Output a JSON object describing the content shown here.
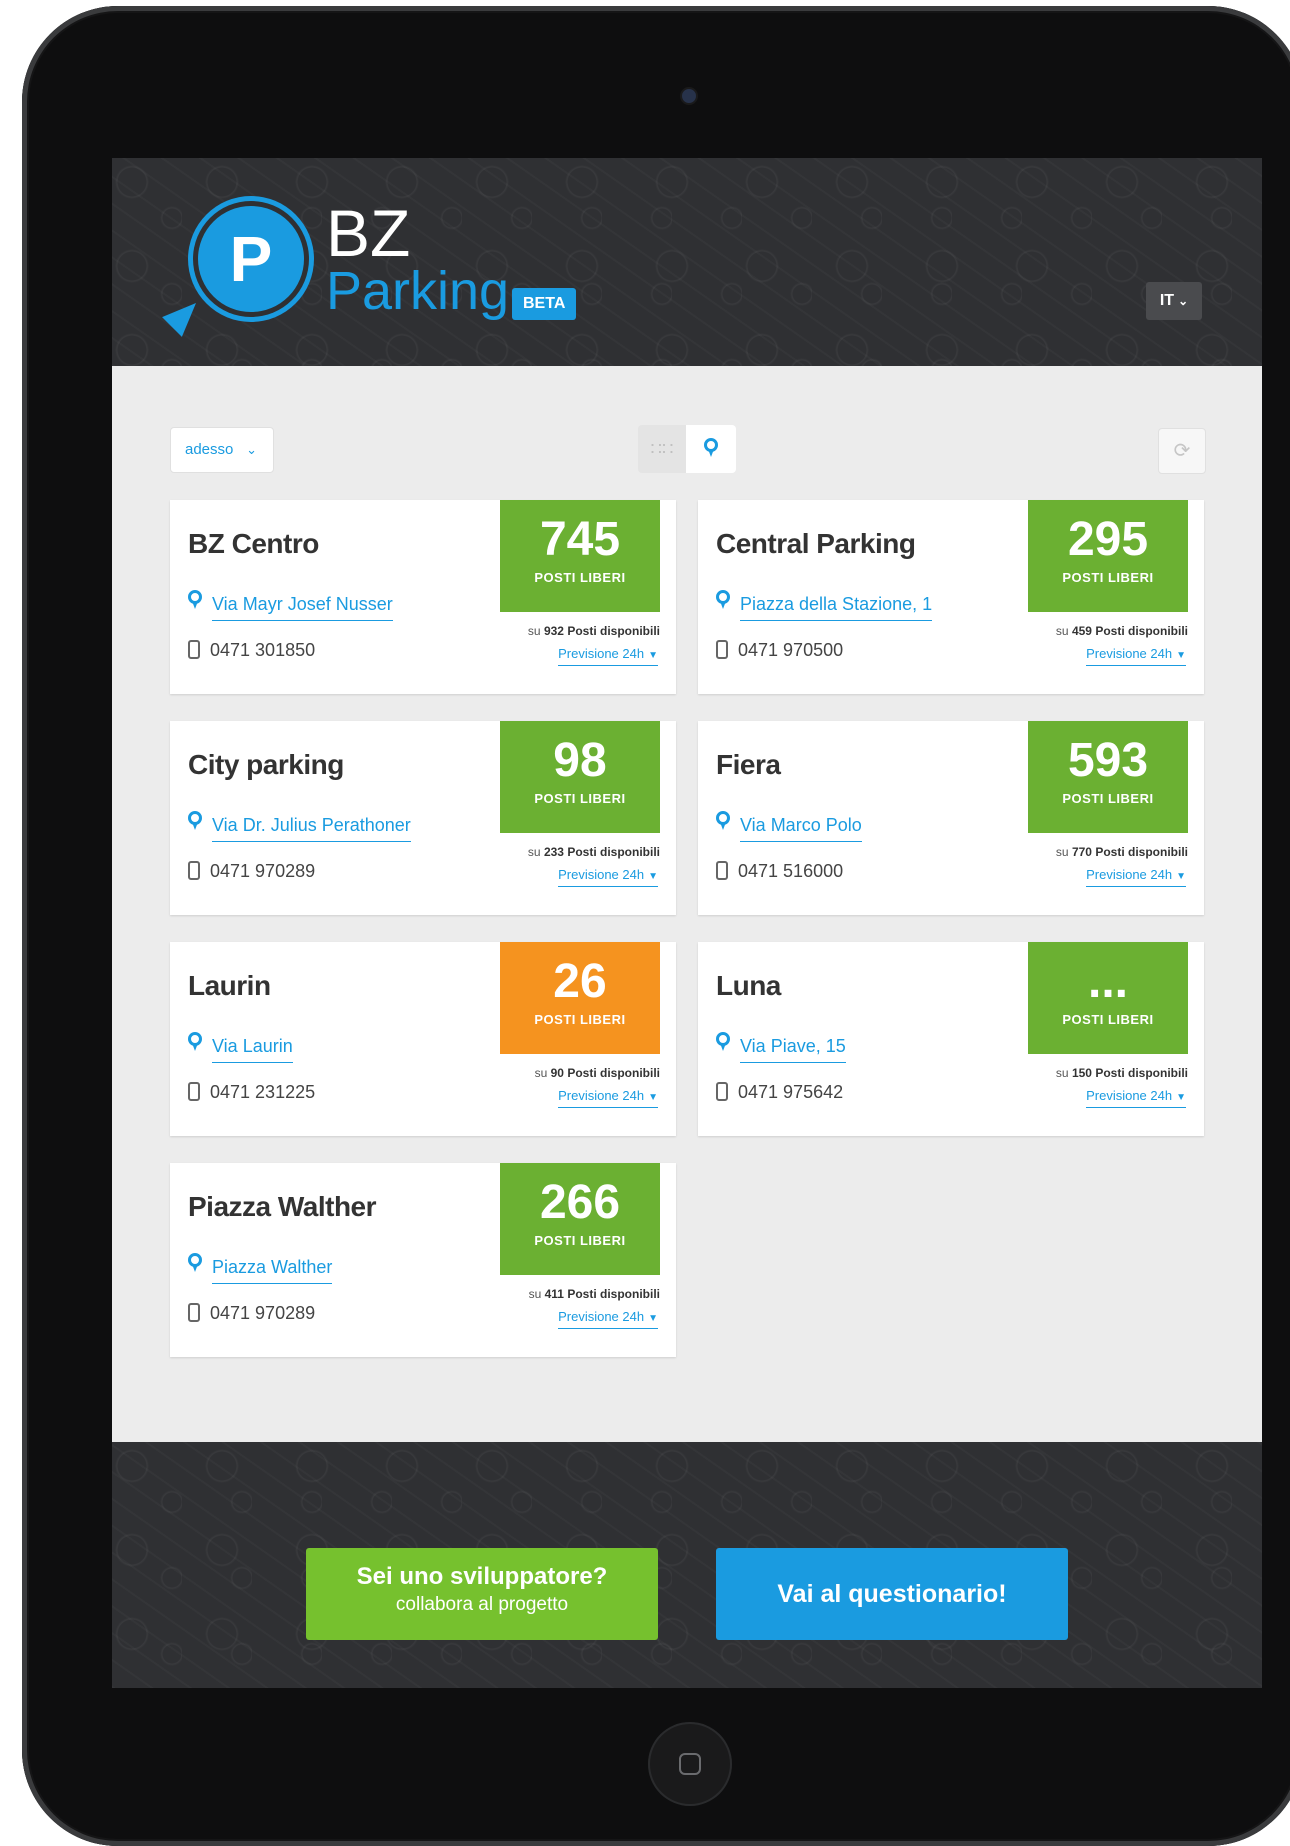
{
  "app": {
    "logo_letter": "P",
    "logo_bz": "BZ",
    "logo_parking": "Parking",
    "beta_badge": "BETA",
    "language": "IT",
    "colors": {
      "accent": "#1a9be0",
      "green": "#6bb032",
      "orange": "#f5931f",
      "dev_button": "#76c12e"
    }
  },
  "toolbar": {
    "time_filter": "adesso",
    "view_grid_icon": "grid-icon",
    "view_map_icon": "map-pin-icon",
    "refresh_icon": "refresh-icon"
  },
  "parkings": [
    {
      "name": "BZ Centro",
      "address": "Via Mayr Josef Nusser",
      "phone": "0471 301850",
      "free": "745",
      "free_label": "POSTI LIBERI",
      "total_prefix": "su",
      "total": "932",
      "total_suffix": "Posti disponibili",
      "forecast": "Previsione 24h",
      "status": "green"
    },
    {
      "name": "Central Parking",
      "address": "Piazza della Stazione, 1",
      "phone": "0471 970500",
      "free": "295",
      "free_label": "POSTI LIBERI",
      "total_prefix": "su",
      "total": "459",
      "total_suffix": "Posti disponibili",
      "forecast": "Previsione 24h",
      "status": "green"
    },
    {
      "name": "City parking",
      "address": "Via Dr. Julius Perathoner",
      "phone": "0471 970289",
      "free": "98",
      "free_label": "POSTI LIBERI",
      "total_prefix": "su",
      "total": "233",
      "total_suffix": "Posti disponibili",
      "forecast": "Previsione 24h",
      "status": "green"
    },
    {
      "name": "Fiera",
      "address": "Via Marco Polo",
      "phone": "0471 516000",
      "free": "593",
      "free_label": "POSTI LIBERI",
      "total_prefix": "su",
      "total": "770",
      "total_suffix": "Posti disponibili",
      "forecast": "Previsione 24h",
      "status": "green"
    },
    {
      "name": "Laurin",
      "address": "Via Laurin",
      "phone": "0471 231225",
      "free": "26",
      "free_label": "POSTI LIBERI",
      "total_prefix": "su",
      "total": "90",
      "total_suffix": "Posti disponibili",
      "forecast": "Previsione 24h",
      "status": "orange"
    },
    {
      "name": "Luna",
      "address": "Via Piave, 15",
      "phone": "0471 975642",
      "free": "...",
      "free_label": "POSTI LIBERI",
      "total_prefix": "su",
      "total": "150",
      "total_suffix": "Posti disponibili",
      "forecast": "Previsione 24h",
      "status": "green"
    },
    {
      "name": "Piazza Walther",
      "address": "Piazza Walther",
      "phone": "0471 970289",
      "free": "266",
      "free_label": "POSTI LIBERI",
      "total_prefix": "su",
      "total": "411",
      "total_suffix": "Posti disponibili",
      "forecast": "Previsione 24h",
      "status": "green"
    }
  ],
  "footer": {
    "developer_title": "Sei uno sviluppatore?",
    "developer_subtitle": "collabora al progetto",
    "survey_label": "Vai al questionario!"
  }
}
